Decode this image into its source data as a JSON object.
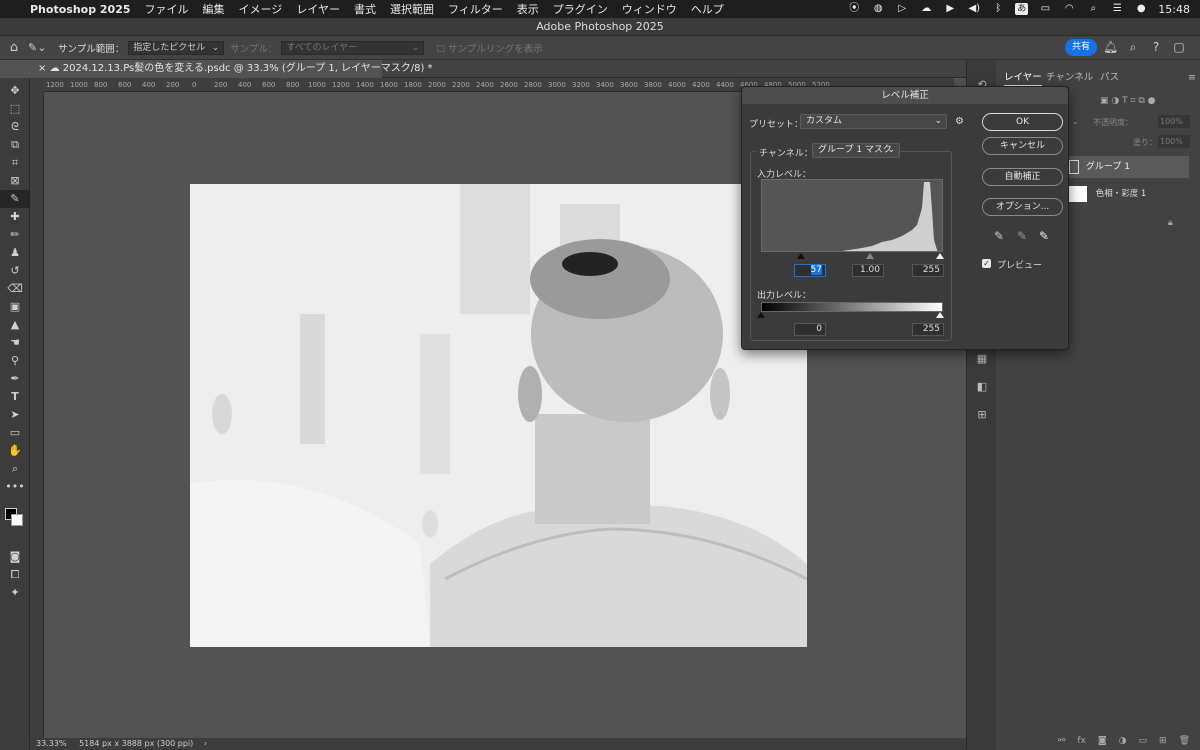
{
  "menubar": {
    "app": "Photoshop 2025",
    "items": [
      "ファイル",
      "編集",
      "イメージ",
      "レイヤー",
      "書式",
      "選択範囲",
      "フィルター",
      "表示",
      "プラグイン",
      "ウィンドウ",
      "ヘルプ"
    ],
    "input_mode": "あ",
    "time": "15:48"
  },
  "window_title": "Adobe Photoshop 2025",
  "options": {
    "sample_range_label": "サンプル範囲：",
    "sample_range_value": "指定したピクセル",
    "sample_label": "サンプル：",
    "sample_value": "すべてのレイヤー",
    "sampling_ring_label": "サンプルリングを表示",
    "share": "共有"
  },
  "doc_tab": {
    "close": "×",
    "title": "2024.12.13.Ps髪の色を変える.psdc @ 33.3% (グループ 1, レイヤーマスク/8) *"
  },
  "ruler_labels": [
    "1200",
    "1000",
    "800",
    "600",
    "400",
    "200",
    "0",
    "200",
    "400",
    "600",
    "800",
    "1000",
    "1200",
    "1400",
    "1600",
    "1800",
    "2000",
    "2200",
    "2400",
    "2600",
    "2800",
    "3000",
    "3200",
    "3400",
    "3600",
    "3800",
    "4000",
    "4200",
    "4400",
    "4600",
    "4800",
    "5000",
    "5200"
  ],
  "status": {
    "zoom": "33.33%",
    "doc_info": "5184 px x 3888 px (300 ppi)",
    "arrow": "›"
  },
  "panel": {
    "tabs": [
      "レイヤー",
      "チャンネル",
      "パス"
    ],
    "opacity_label": "不透明度：",
    "opacity_value": "100%",
    "fill_label": "塗り：",
    "fill_value": "100%",
    "layers": [
      "グループ 1",
      "色相・彩度 1"
    ]
  },
  "levels": {
    "title": "レベル補正",
    "preset_label": "プリセット：",
    "preset_value": "カスタム",
    "channel_label": "チャンネル：",
    "channel_value": "グループ 1 マスク",
    "input_label": "入力レベル：",
    "input_values": [
      "57",
      "1.00",
      "255"
    ],
    "output_label": "出力レベル：",
    "output_values": [
      "0",
      "255"
    ],
    "buttons": {
      "ok": "OK",
      "cancel": "キャンセル",
      "auto": "自動補正",
      "options": "オプション..."
    },
    "preview_label": "プレビュー",
    "preview_checked": true
  }
}
